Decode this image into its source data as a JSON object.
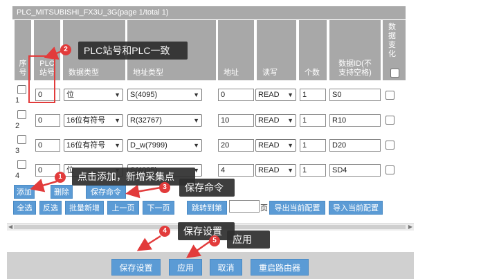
{
  "window": {
    "title": "PLC_MITSUBISHI_FX3U_3G(page 1/total 1)"
  },
  "columns": {
    "seq": "序号",
    "station_l1": "PLC",
    "station_l2": "站号",
    "data_type": "数据类型",
    "addr_type": "地址类型",
    "address": "地址",
    "rw": "读写",
    "count": "个数",
    "data_id_l1": "数据ID(不",
    "data_id_l2": "支持空格)",
    "change_l1": "数",
    "change_l2": "据",
    "change_l3": "变",
    "change_l4": "化"
  },
  "rows": [
    {
      "seq": "1",
      "station": "0",
      "data_type": "位",
      "addr_type": "S(4095)",
      "address": "0",
      "rw": "READ",
      "count": "1",
      "data_id": "S0"
    },
    {
      "seq": "2",
      "station": "0",
      "data_type": "16位有符号",
      "addr_type": "R(32767)",
      "address": "10",
      "rw": "READ",
      "count": "1",
      "data_id": "R10"
    },
    {
      "seq": "3",
      "station": "0",
      "data_type": "16位有符号",
      "addr_type": "D_w(7999)",
      "address": "20",
      "rw": "READ",
      "count": "1",
      "data_id": "D20"
    },
    {
      "seq": "4",
      "station": "0",
      "data_type": "位",
      "addr_type": "S(4095)",
      "address": "4",
      "rw": "READ",
      "count": "1",
      "data_id": "SD4"
    }
  ],
  "buttons": {
    "add": "添加",
    "delete": "删除",
    "save_cmd": "保存命令",
    "select_all": "全选",
    "invert": "反选",
    "batch_add": "批量新增",
    "prev": "上一页",
    "next": "下一页",
    "goto": "跳转到第",
    "page_suffix": "页",
    "export": "导出当前配置",
    "import": "导入当前配置"
  },
  "footer": {
    "save_settings": "保存设置",
    "apply": "应用",
    "cancel": "取消",
    "reboot": "重启路由器"
  },
  "annotations": [
    {
      "num": "1",
      "text": "点击添加，新增采集点"
    },
    {
      "num": "2",
      "text": "PLC站号和PLC一致"
    },
    {
      "num": "3",
      "text": "保存命令"
    },
    {
      "num": "4",
      "text": "保存设置"
    },
    {
      "num": "5",
      "text": "应用"
    }
  ],
  "colors": {
    "accent": "#5b9bd5",
    "header": "#a8a8a8",
    "callout": "#2e2e2e",
    "marker": "#e23b3b"
  }
}
